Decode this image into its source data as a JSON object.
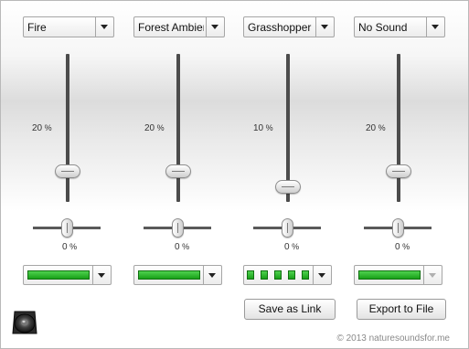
{
  "channels": [
    {
      "sound": "Fire",
      "volume_label": "20",
      "volume_unit": "%",
      "volume": 0.2,
      "balance_label": "0",
      "balance_unit": "%",
      "balance": 0,
      "modulation": "steady",
      "modulation_enabled": true
    },
    {
      "sound": "Forest Ambien",
      "volume_label": "20",
      "volume_unit": "%",
      "volume": 0.2,
      "balance_label": "0",
      "balance_unit": "%",
      "balance": 0,
      "modulation": "steady",
      "modulation_enabled": true
    },
    {
      "sound": "Grasshopper",
      "volume_label": "10",
      "volume_unit": "%",
      "volume": 0.1,
      "balance_label": "0",
      "balance_unit": "%",
      "balance": 0,
      "modulation": "pulsing",
      "modulation_enabled": true
    },
    {
      "sound": "No Sound",
      "volume_label": "20",
      "volume_unit": "%",
      "volume": 0.2,
      "balance_label": "0",
      "balance_unit": "%",
      "balance": 0,
      "modulation": "steady",
      "modulation_enabled": false
    }
  ],
  "buttons": {
    "save_link": "Save as Link",
    "export_file": "Export to File"
  },
  "footer": {
    "copyright": "© 2013 naturesoundsfor.me",
    "speaker_icon": "speaker-icon"
  },
  "colors": {
    "level_bar": "#22aa22",
    "track": "#4c4c4c"
  }
}
